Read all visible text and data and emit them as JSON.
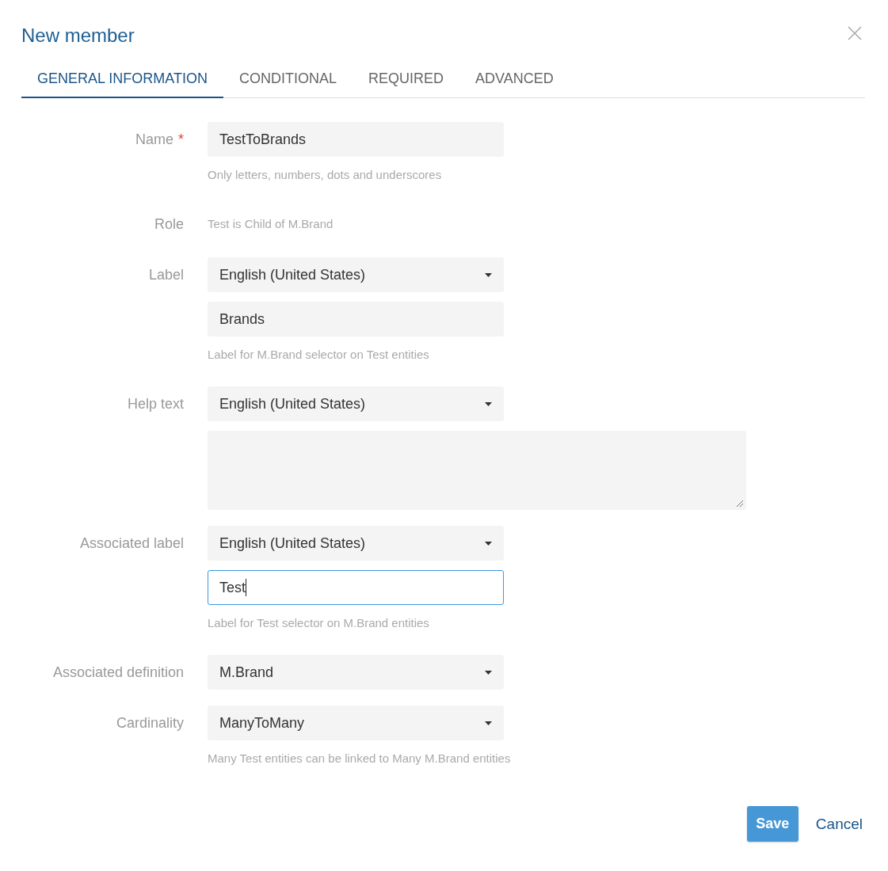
{
  "dialog": {
    "title": "New member"
  },
  "tabs": [
    {
      "label": "GENERAL INFORMATION",
      "selected": true
    },
    {
      "label": "CONDITIONAL",
      "selected": false
    },
    {
      "label": "REQUIRED",
      "selected": false
    },
    {
      "label": "ADVANCED",
      "selected": false
    }
  ],
  "fields": [
    {
      "kind": "text",
      "label": "Name",
      "required_mark": "*",
      "value": "TestToBrands",
      "focused": false,
      "hint": "Only letters, numbers, dots and underscores"
    },
    {
      "kind": "static",
      "label": "Role",
      "value": "Test is Child of M.Brand"
    },
    {
      "kind": "select-text",
      "label": "Label",
      "select": "English (United States)",
      "value": "Brands",
      "focused": false,
      "hint": "Label for M.Brand selector on Test entities"
    },
    {
      "kind": "select-textarea",
      "label": "Help text",
      "select": "English (United States)"
    },
    {
      "kind": "select-text",
      "label": "Associated label",
      "select": "English (United States)",
      "value": "Test",
      "focused": true,
      "hint": "Label for Test selector on M.Brand entities"
    },
    {
      "kind": "select",
      "label": "Associated definition",
      "value": "M.Brand"
    },
    {
      "kind": "select",
      "label": "Cardinality",
      "value": "ManyToMany",
      "hint": "Many Test entities can be linked to Many M.Brand entities"
    }
  ],
  "buttons": [
    {
      "kind": "primary",
      "label": "Save"
    },
    {
      "kind": "link",
      "label": "Cancel"
    }
  ]
}
